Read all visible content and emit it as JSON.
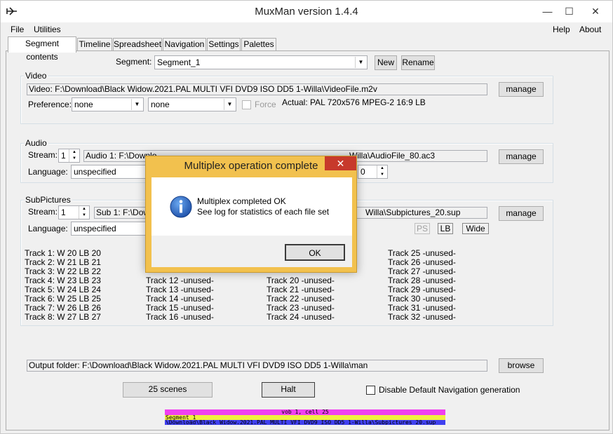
{
  "window": {
    "title": "MuxMan version 1.4.4",
    "minimize": "—",
    "maximize": "☐",
    "close": "✕"
  },
  "menu": {
    "file": "File",
    "utilities": "Utilities",
    "help": "Help",
    "about": "About"
  },
  "tabs": [
    "Segment contents",
    "Timeline",
    "Spreadsheet",
    "Navigation",
    "Settings",
    "Palettes"
  ],
  "segment": {
    "label": "Segment:",
    "value": "Segment_1",
    "new": "New",
    "rename": "Rename"
  },
  "video": {
    "title": "Video",
    "file": "Video: F:\\Download\\Black Widow.2021.PAL MULTI VFI DVD9 ISO DD5 1-Willa\\VideoFile.m2v",
    "manage": "manage",
    "preference_label": "Preference:",
    "pref1": "none",
    "pref2": "none",
    "force": "Force",
    "actual": "Actual: PAL  720x576  MPEG-2  16:9 LB"
  },
  "audio": {
    "title": "Audio",
    "stream_label": "Stream:",
    "stream": "1",
    "file_left": "Audio 1: F:\\Downlo",
    "file_right": "Willa\\AudioFile_80.ac3",
    "manage": "manage",
    "language_label": "Language:",
    "language": "unspecified",
    "spin2": "0"
  },
  "subpictures": {
    "title": "SubPictures",
    "stream_label": "Stream:",
    "stream": "1",
    "file_left": "Sub 1: F:\\Dow",
    "file_right": "Willa\\Subpictures_20.sup",
    "manage": "manage",
    "language_label": "Language:",
    "language": "unspecified",
    "ps": "PS",
    "lb": "LB",
    "wide": "Wide",
    "tracks_col1": [
      "Track 1:  W 20  LB 20",
      "Track 2:  W 21  LB 21",
      "Track 3:  W 22  LB 22",
      "Track 4:  W 23  LB 23",
      "Track 5:  W 24  LB 24",
      "Track 6:  W 25  LB 25",
      "Track 7:  W 26  LB 26",
      "Track 8:  W 27  LB 27"
    ],
    "tracks_col2": [
      "Track 12  -unused-",
      "Track 13  -unused-",
      "Track 14  -unused-",
      "Track 15  -unused-",
      "Track 16  -unused-"
    ],
    "tracks_col3": [
      "Track 20  -unused-",
      "Track 21  -unused-",
      "Track 22  -unused-",
      "Track 23  -unused-",
      "Track 24  -unused-"
    ],
    "tracks_col4": [
      "Track 25  -unused-",
      "Track 26  -unused-",
      "Track 27  -unused-",
      "Track 28  -unused-",
      "Track 29  -unused-",
      "Track 30  -unused-",
      "Track 31  -unused-",
      "Track 32  -unused-"
    ]
  },
  "output": {
    "folder": "Output folder: F:\\Download\\Black Widow.2021.PAL MULTI VFI DVD9 ISO DD5 1-Willa\\man",
    "browse": "browse"
  },
  "bottom": {
    "scenes": "25 scenes",
    "halt": "Halt",
    "disable_nav": "Disable Default Navigation generation"
  },
  "progress": {
    "line1": "vob 1, cell 25",
    "line2": "Segment_1",
    "line3": "\\Download\\Black Widow.2021.PAL MULTI VFI DVD9 ISO DD5 1-Willa\\Subpictures_20.sup",
    "colors": {
      "magenta": "#f040f0",
      "yellow": "#f0f040",
      "blue": "#4040f0"
    }
  },
  "dialog": {
    "title": "Multiplex operation complete",
    "line1": "Multiplex completed OK",
    "line2": "See log for statistics of each file set",
    "ok": "OK",
    "info_icon": "info-icon",
    "accent": "#f2c14e"
  }
}
